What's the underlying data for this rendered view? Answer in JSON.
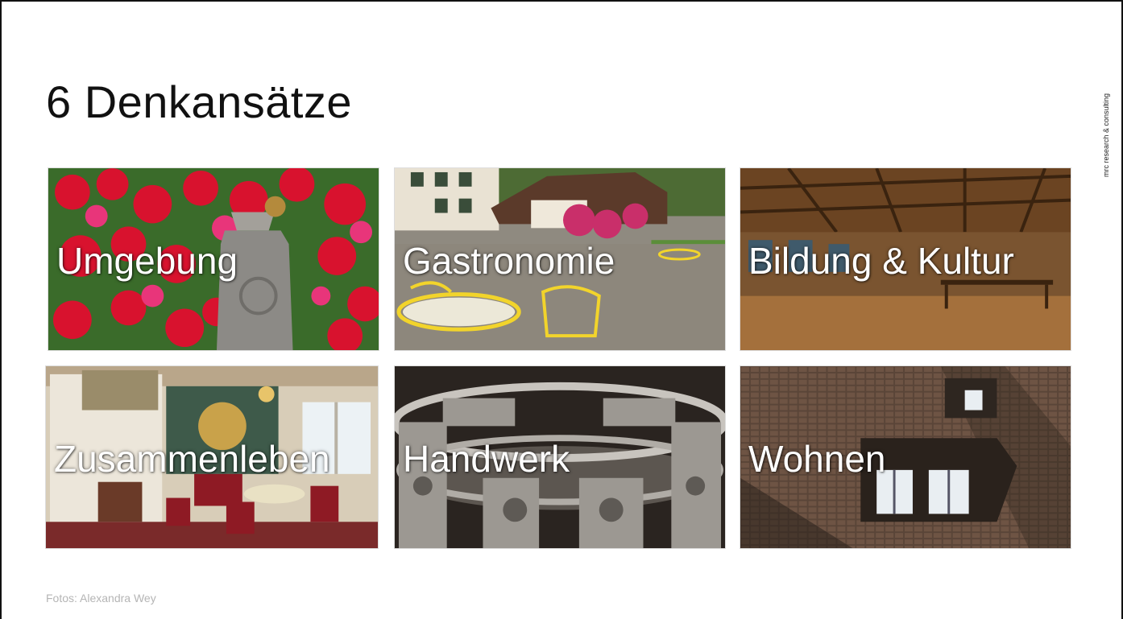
{
  "slide": {
    "title": "6 Denkansätze",
    "side_label": "mrc research & consulting",
    "credit": "Fotos: Alexandra Wey"
  },
  "tiles": [
    {
      "label": "Umgebung",
      "photo": "red-roses-stone-post"
    },
    {
      "label": "Gastronomie",
      "photo": "garden-yellow-chairs"
    },
    {
      "label": "Bildung & Kultur",
      "photo": "wood-paneled-hall"
    },
    {
      "label": "Zusammenleben",
      "photo": "parlor-red-chairs"
    },
    {
      "label": "Handwerk",
      "photo": "ornate-metal-ring"
    },
    {
      "label": "Wohnen",
      "photo": "tiled-roof-dormer"
    }
  ]
}
